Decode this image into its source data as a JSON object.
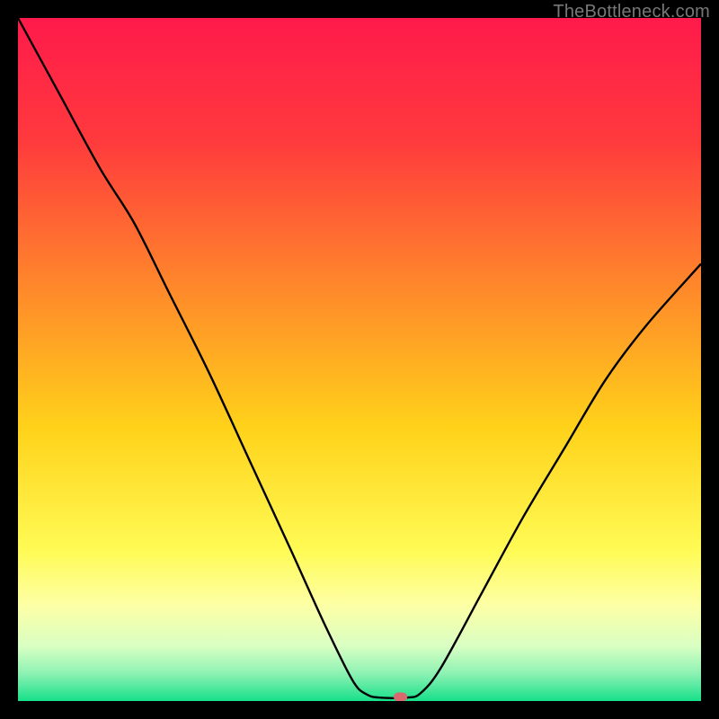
{
  "watermark": "TheBottleneck.com",
  "chart_data": {
    "type": "line",
    "title": "",
    "xlabel": "",
    "ylabel": "",
    "xlim": [
      0,
      100
    ],
    "ylim": [
      0,
      100
    ],
    "background_gradient_stops": [
      {
        "offset": 0.0,
        "color": "#ff1a4b"
      },
      {
        "offset": 0.18,
        "color": "#ff3a3d"
      },
      {
        "offset": 0.4,
        "color": "#ff8a2a"
      },
      {
        "offset": 0.6,
        "color": "#ffd21a"
      },
      {
        "offset": 0.78,
        "color": "#fffb55"
      },
      {
        "offset": 0.86,
        "color": "#fdffa6"
      },
      {
        "offset": 0.92,
        "color": "#d9ffc3"
      },
      {
        "offset": 0.96,
        "color": "#8cf2b3"
      },
      {
        "offset": 1.0,
        "color": "#17e08a"
      }
    ],
    "series": [
      {
        "name": "bottleneck-curve",
        "color": "#000000",
        "width": 2.4,
        "points": [
          {
            "x": 0,
            "y": 100
          },
          {
            "x": 6,
            "y": 89
          },
          {
            "x": 12,
            "y": 78
          },
          {
            "x": 17,
            "y": 70
          },
          {
            "x": 22,
            "y": 60
          },
          {
            "x": 28,
            "y": 48
          },
          {
            "x": 34,
            "y": 35
          },
          {
            "x": 40,
            "y": 22
          },
          {
            "x": 45,
            "y": 11
          },
          {
            "x": 49,
            "y": 3
          },
          {
            "x": 51,
            "y": 1
          },
          {
            "x": 53,
            "y": 0.5
          },
          {
            "x": 57,
            "y": 0.5
          },
          {
            "x": 59,
            "y": 1.2
          },
          {
            "x": 62,
            "y": 5
          },
          {
            "x": 68,
            "y": 16
          },
          {
            "x": 74,
            "y": 27
          },
          {
            "x": 80,
            "y": 37
          },
          {
            "x": 86,
            "y": 47
          },
          {
            "x": 92,
            "y": 55
          },
          {
            "x": 100,
            "y": 64
          }
        ]
      }
    ],
    "marker": {
      "name": "optimal-point",
      "x": 56,
      "y": 0.6,
      "color": "#d9686f"
    }
  }
}
